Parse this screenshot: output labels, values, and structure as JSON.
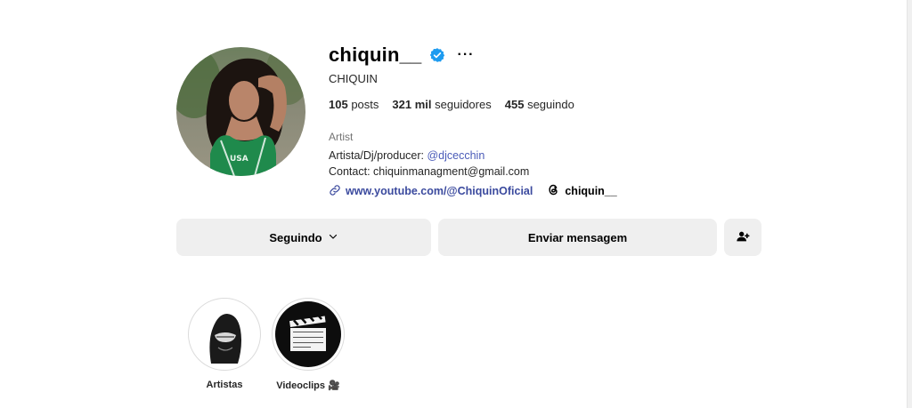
{
  "profile": {
    "username": "chiquin__",
    "full_name": "CHIQUIN",
    "verified": true,
    "more_label": "···",
    "avatar_icon": "profile-photo"
  },
  "stats": {
    "posts_count": "105",
    "posts_label": "posts",
    "followers_count": "321 mil",
    "followers_label": "seguidores",
    "following_count": "455",
    "following_label": "seguindo"
  },
  "bio": {
    "category": "Artist",
    "line1_text": "Artista/Dj/producer: ",
    "line1_mention": "@djcecchin",
    "line2": "Contact: chiquinmanagment@gmail.com",
    "link_url": "www.youtube.com/@ChiquinOficial",
    "link_icon": "link-icon",
    "threads_handle": "chiquin__",
    "threads_icon": "threads-icon"
  },
  "actions": {
    "following_label": "Seguindo",
    "message_label": "Enviar mensagem",
    "add_user_icon": "add-user-icon"
  },
  "highlights": [
    {
      "label": "Artistas"
    },
    {
      "label": "Videoclips 🎥"
    }
  ],
  "colors": {
    "verified_blue": "#1d9bf0",
    "link_blue": "#3b4a9e",
    "button_bg": "#efefef"
  }
}
